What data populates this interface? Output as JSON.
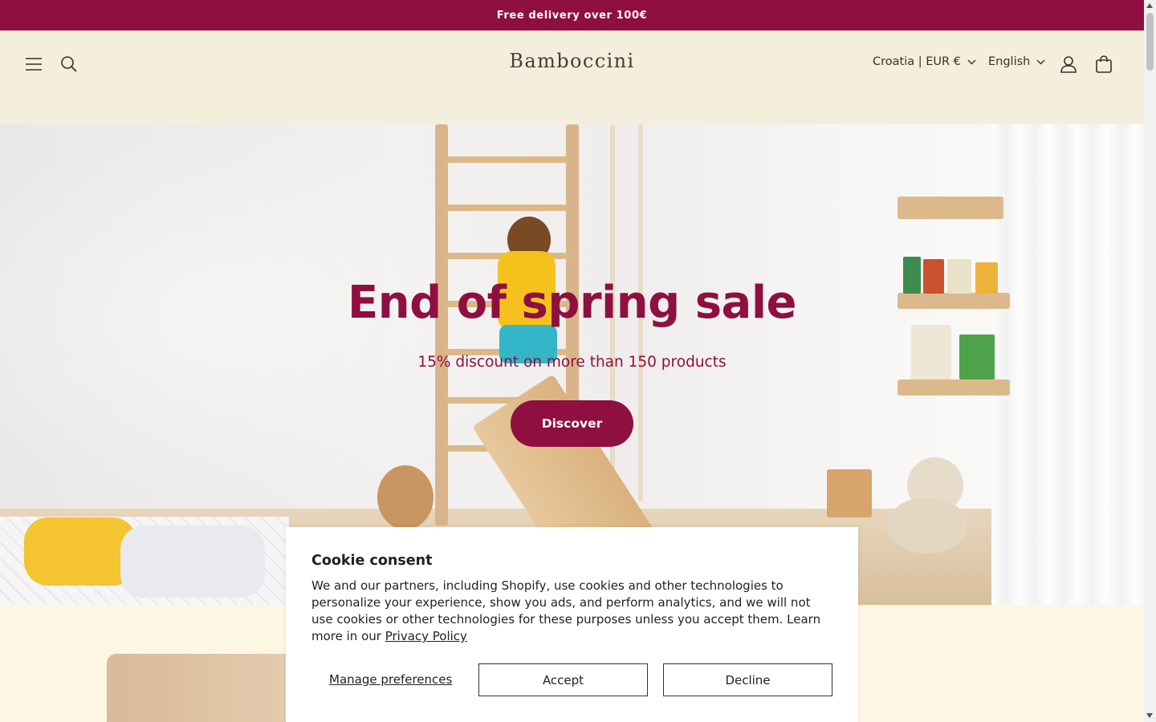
{
  "announcement": {
    "text": "Free delivery over 100€"
  },
  "header": {
    "logo": "Bamboccini",
    "country_selector": "Croatia | EUR €",
    "language_selector": "English",
    "icons": [
      "menu-icon",
      "search-icon",
      "account-icon",
      "cart-icon"
    ]
  },
  "hero": {
    "title": "End of spring sale",
    "subtitle": "15% discount on more than 150 products",
    "button": "Discover"
  },
  "cookie": {
    "title": "Cookie consent",
    "body": "We and our partners, including Shopify, use cookies and other technologies to personalize your experience, show you ads, and perform analytics, and we will not use cookies or other technologies for these purposes unless you accept them. Learn more in our",
    "privacy_link": "Privacy Policy",
    "manage": "Manage preferences",
    "accept": "Accept",
    "decline": "Decline"
  },
  "colors": {
    "brand": "#8e0f40",
    "header_bg": "#f3efdc",
    "page_bg": "#fbf7e3"
  }
}
